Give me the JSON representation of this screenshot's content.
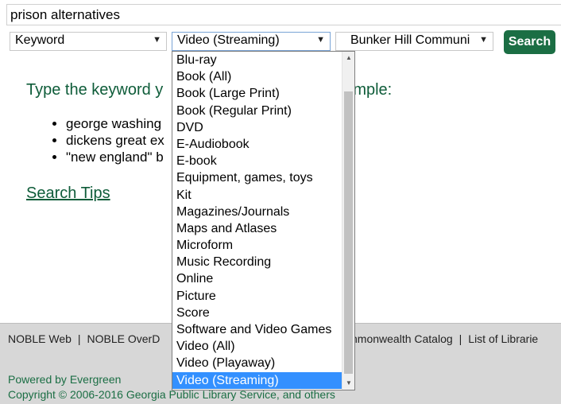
{
  "search": {
    "query": "prison alternatives"
  },
  "filters": {
    "search_type": "Keyword",
    "format": "Video (Streaming)",
    "library": "Bunker Hill Communi",
    "search_button": "Search"
  },
  "main": {
    "intro": "Type the keyword y",
    "intro_tail": "mple:",
    "examples": [
      "george washing",
      "dickens great ex",
      "\"new england\" b"
    ],
    "search_tips": "Search Tips"
  },
  "dropdown": {
    "options": [
      "Blu-ray",
      "Book (All)",
      "Book (Large Print)",
      "Book (Regular Print)",
      "DVD",
      "E-Audiobook",
      "E-book",
      "Equipment, games, toys",
      "Kit",
      "Magazines/Journals",
      "Maps and Atlases",
      "Microform",
      "Music Recording",
      "Online",
      "Picture",
      "Score",
      "Software and Video Games",
      "Video (All)",
      "Video (Playaway)",
      "Video (Streaming)"
    ],
    "selected": "Video (Streaming)"
  },
  "footer": {
    "link_1": "NOBLE Web",
    "link_2": "NOBLE OverD",
    "link_3": "ommonwealth Catalog",
    "link_4": "List of Librarie",
    "powered": "Powered by Evergreen",
    "copyright": "Copyright © 2006-2016 Georgia Public Library Service, and others"
  },
  "colors": {
    "accent": "#1b6e44",
    "highlight": "#3390ff",
    "footer_bg": "#d7d7d7"
  }
}
